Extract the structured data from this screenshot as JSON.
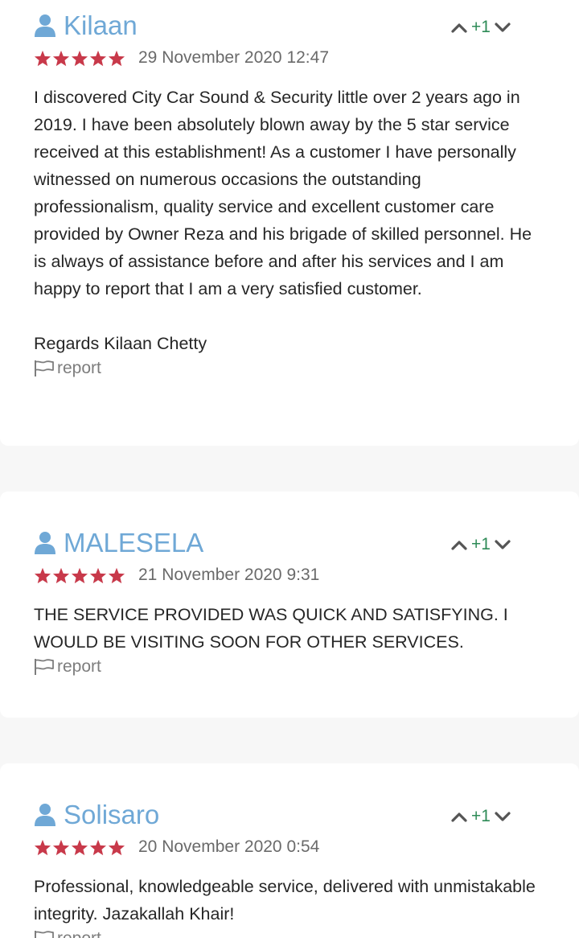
{
  "reviews": [
    {
      "author": "Kilaan",
      "votes": "+1",
      "date": "29 November 2020 12:47",
      "rating": 5,
      "paragraphs": [
        "I discovered City Car Sound & Security little over 2 years ago in 2019. I have been absolutely blown away by the 5 star service received at this establishment! As a customer I have personally witnessed on numerous occasions the outstanding professionalism, quality service and excellent customer care provided by Owner Reza and his brigade of skilled personnel. He is always of assistance before and after his services and I am happy to report that I am a very satisfied customer.",
        "Regards Kilaan Chetty"
      ],
      "report_label": "report"
    },
    {
      "author": "MALESELA",
      "votes": "+1",
      "date": "21 November 2020 9:31",
      "rating": 5,
      "paragraphs": [
        "THE SERVICE PROVIDED WAS QUICK AND SATISFYING. I WOULD BE VISITING SOON FOR OTHER SERVICES."
      ],
      "report_label": "report"
    },
    {
      "author": "Solisaro",
      "votes": "+1",
      "date": "20 November 2020 0:54",
      "rating": 5,
      "paragraphs": [
        "Professional, knowledgeable service, delivered with unmistakable integrity. Jazakallah Khair!"
      ],
      "report_label": "report"
    }
  ],
  "colors": {
    "author": "#6fa8d6",
    "star": "#c8394a",
    "vote_count": "#2e8b57",
    "vote_arrow": "#555555",
    "muted": "#7d7d7d",
    "body": "#262626"
  }
}
